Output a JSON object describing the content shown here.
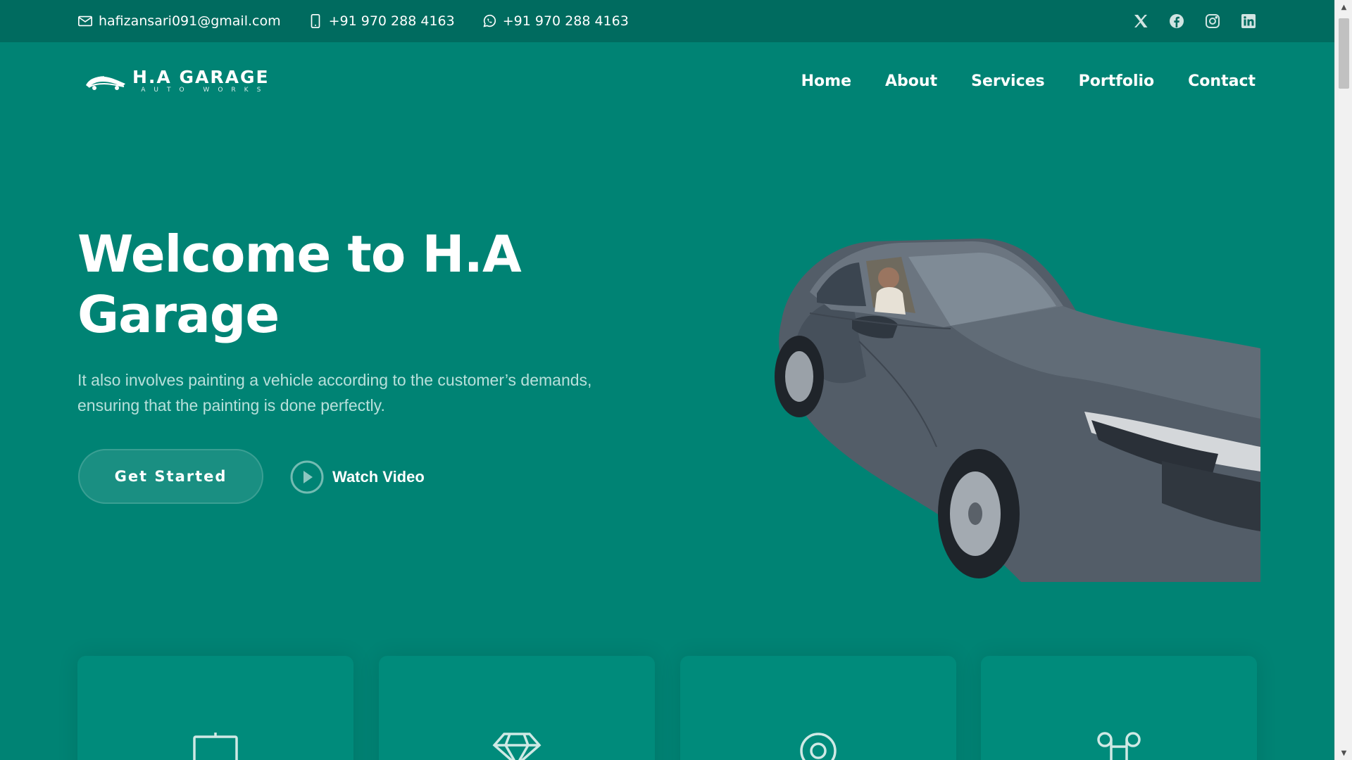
{
  "topbar": {
    "email": "hafizansari091@gmail.com",
    "phone": "+91 970 288 4163",
    "whatsapp": "+91 970 288 4163",
    "icons": [
      "envelope-icon",
      "phone-icon",
      "whatsapp-icon"
    ],
    "social": [
      "x-twitter-icon",
      "facebook-icon",
      "instagram-icon",
      "linkedin-icon"
    ]
  },
  "header": {
    "logo": {
      "brand": "H.A GARAGE",
      "tagline": "AUTO WORKS"
    },
    "nav": [
      "Home",
      "About",
      "Services",
      "Portfolio",
      "Contact"
    ]
  },
  "hero": {
    "title": "Welcome to H.A Garage",
    "text": "It also involves painting a vehicle according to the customer’s demands, ensuring that the painting is done perfectly.",
    "primary_button": "Get Started",
    "video_link": "Watch Video"
  },
  "features": {
    "icons": [
      "easel-icon",
      "gem-icon",
      "target-icon",
      "command-icon"
    ]
  },
  "colors": {
    "background": "#008374",
    "topbar": "#006b5f",
    "text_muted": "#b8e0db",
    "card": "#008b7b"
  }
}
